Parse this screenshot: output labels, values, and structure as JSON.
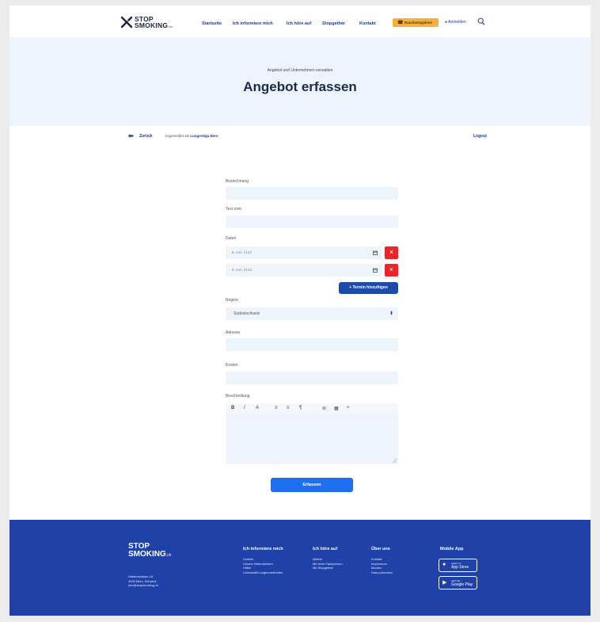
{
  "brand": {
    "line1": "STOP",
    "line2": "SMOKING",
    "suffix": ".ch"
  },
  "nav": [
    "Startseite",
    "Ich informiere mich",
    "Ich höre auf",
    "Stopgether",
    "Kontakt"
  ],
  "header": {
    "hotline_label": "Rauchstopplinie",
    "user_label": "Anmelden"
  },
  "hero": {
    "subtitle": "Angebot und Unternehmen verwalten",
    "title": "Angebot erfassen"
  },
  "crumb": {
    "back_label": "Zurück",
    "logged_in_prefix": "Angemeldet als",
    "logged_in_name": "Lungenliga Bern",
    "logout_label": "Logout"
  },
  "form": {
    "title_label": "Bezeichnung",
    "subtitle_label": "Text zum",
    "dates_label": "Daten",
    "dates": [
      "tt. mm. 2122",
      "tt. mm. 2122"
    ],
    "remove_label": "x",
    "add_date_label": "+ Termin hinzufügen",
    "region_label": "Region",
    "region_value": "Südostschweiz",
    "address_label": "Adresse",
    "costs_label": "Kosten",
    "description_label": "Beschreibung",
    "toolbar": [
      "B",
      "I",
      "A",
      "≡",
      "≡",
      "¶",
      "⊘",
      "▦",
      "+"
    ],
    "submit_label": "Erfassen"
  },
  "footer": {
    "logo_line1": "STOP",
    "logo_line2": "SMOKING",
    "logo_suffix": ".ch",
    "address": [
      "Haldenstrasse 18",
      "3000 Bern, Schweiz",
      "info@stopsmoking.ch"
    ],
    "col1_heading": "Ich informiere mich",
    "col1_links": [
      "Vorteile",
      "Unsere Nebenbeiden",
      "Hilfen",
      "Lebensstil/Lungenmethoden"
    ],
    "col2_heading": "Ich höre auf",
    "col2_links": [
      "Alleine",
      "Mit einer Fachperson",
      "Mit Stopgether"
    ],
    "col3_heading": "Über uns",
    "col3_links": [
      "Kontakt",
      "Impressum",
      "Medien",
      "Data protection"
    ],
    "app_heading": "Mobile App",
    "appstore_small": "Laden im",
    "appstore_label": "App Store",
    "playstore_small": "Jetzt bei",
    "playstore_label": "Google Play"
  },
  "colors": {
    "primary": "#1f41a8",
    "accent": "#f5b040",
    "danger": "#e8262b",
    "field": "#edf4fc",
    "submit": "#1e6ff0"
  }
}
